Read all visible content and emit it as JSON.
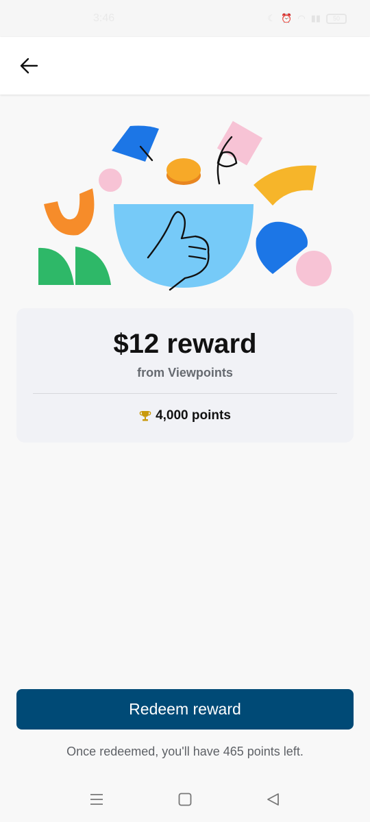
{
  "status_bar": {
    "time": "3:46",
    "battery": "50"
  },
  "reward": {
    "title": "$12 reward",
    "source": "from Viewpoints",
    "points_icon": "trophy-icon",
    "points": "4,000 points"
  },
  "actions": {
    "redeem_label": "Redeem reward",
    "note": "Once redeemed, you'll have 465 points left."
  },
  "icons": {
    "back": "arrow-left-icon",
    "nav_menu": "menu-icon",
    "nav_home": "home-square-icon",
    "nav_back": "triangle-back-icon"
  },
  "colors": {
    "primary": "#004a76",
    "card_bg": "#f1f2f6",
    "trophy": "#c99a0d"
  }
}
